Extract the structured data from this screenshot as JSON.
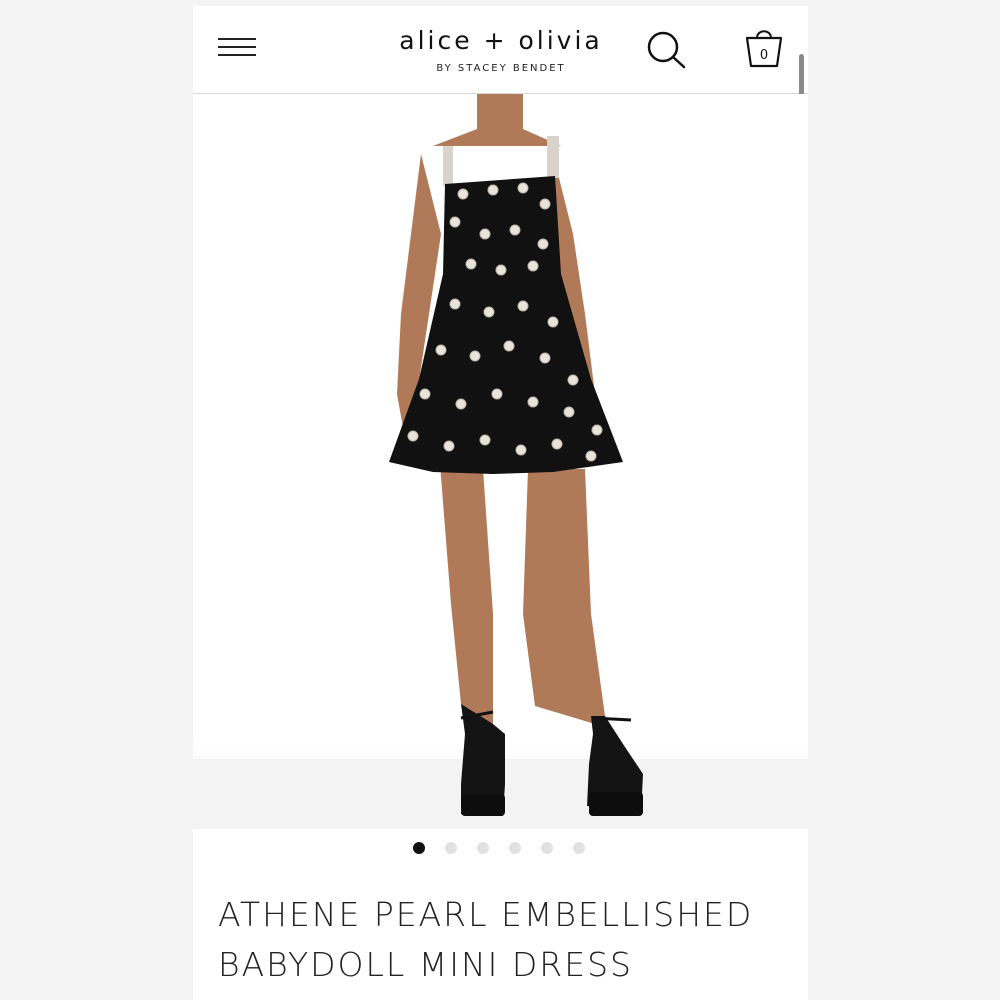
{
  "header": {
    "logo_text": "alice + olivia",
    "tagline": "BY STACEY BENDET",
    "cart_count": "0"
  },
  "icons": {
    "menu": "hamburger-menu-icon",
    "search": "search-icon",
    "cart": "shopping-bag-icon"
  },
  "carousel": {
    "total": 6,
    "active_index": 0
  },
  "product": {
    "title_line1": "ATHENE PEARL EMBELLISHED",
    "title_line2": "BABYDOLL MINI DRESS"
  },
  "colors": {
    "dress": "#111111",
    "skin": "#b07a58",
    "pearl": "#e8e4dc",
    "dot_active": "#111111",
    "dot_inactive": "#e1e1e1"
  }
}
